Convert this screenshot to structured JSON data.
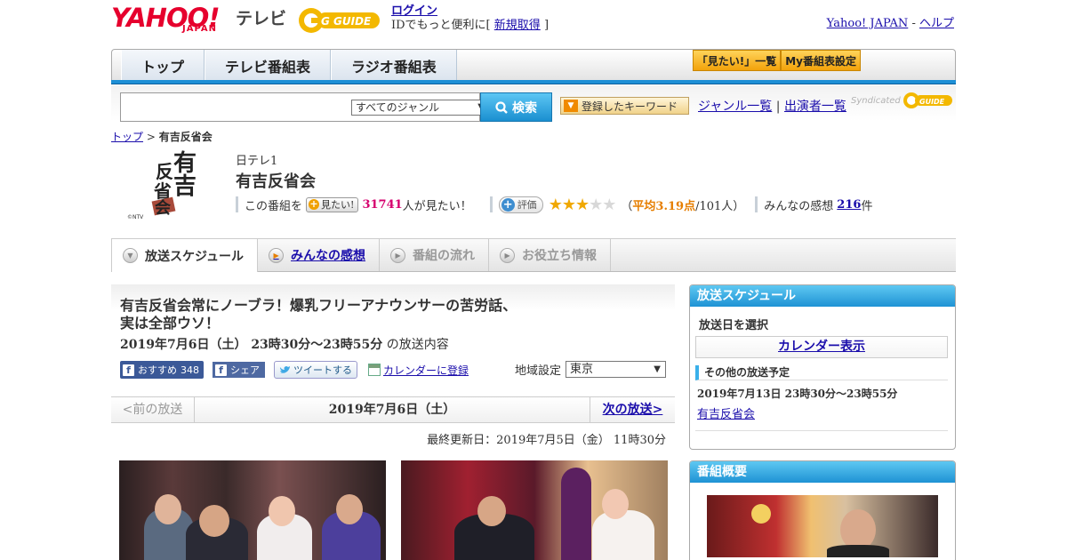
{
  "header": {
    "logo_yahoo": "YAHOO!",
    "logo_japan": "JAPAN",
    "logo_tv": "テレビ",
    "logo_gguide": "G GUIDE",
    "login_label": "ログイン",
    "login_desc": "IDでもっと便利に[",
    "register_label": "新規取得",
    "register_close": "]",
    "yahoo_japan_link": "Yahoo! JAPAN",
    "separator": "-",
    "help_link": "ヘルプ"
  },
  "nav": {
    "tabs": [
      "トップ",
      "テレビ番組表",
      "ラジオ番組表"
    ],
    "mitai_list": "「見たい!」一覧",
    "my_schedule": "My番組表設定"
  },
  "search": {
    "input_value": "",
    "genre_selected": "すべてのジャンル",
    "search_button": "検索",
    "keyword_button": "登録したキーワード",
    "genre_list_link": "ジャンル一覧",
    "link_separator": "|",
    "performer_list_link": "出演者一覧",
    "syndicated": "Syndicated",
    "syndicated_logo": "GUIDE"
  },
  "breadcrumb": {
    "top": "トップ",
    "separator": ">",
    "current": "有吉反省会"
  },
  "program": {
    "logo_text": "有吉反省会",
    "logo_credit": "©NTV",
    "station": "日テレ1",
    "title": "有吉反省会",
    "prefix": "この番組を",
    "mitai_button": "見たい!",
    "mitai_count": "31741",
    "mitai_suffix": "人が見たい！",
    "rating_button": "評価",
    "stars_filled": 3,
    "stars_total": 5,
    "rating_open": "（",
    "rating_avg": "平均3.19点",
    "rating_count": "/101人）",
    "kansou_label": "みんなの感想",
    "kansou_count": "216",
    "kansou_suffix": "件"
  },
  "content_tabs": [
    "放送スケジュール",
    "みんなの感想",
    "番組の流れ",
    "お役立ち情報"
  ],
  "episode": {
    "title_line1": "有吉反省会常にノーブラ！爆乳フリーアナウンサーの苦労話、",
    "title_line2": "実は全部ウソ！",
    "air_time": "2019年7月6日（土） 23時30分～23時55分",
    "air_suffix": " の放送内容",
    "fb_recommend": "おすすめ",
    "fb_count": "348",
    "fb_share": "シェア",
    "tweet": "ツイートする",
    "calendar_register": "カレンダーに登録",
    "region_label": "地域設定",
    "region_selected": "東京"
  },
  "pager": {
    "prev": "<前の放送",
    "date": "2019年7月6日（土）",
    "next": "次の放送>"
  },
  "updated": "最終更新日：2019年7月5日（金） 11時30分",
  "sidebar": {
    "schedule_heading": "放送スケジュール",
    "select_date": "放送日を選択",
    "calendar_button": "カレンダー表示",
    "other_heading": "その他の放送予定",
    "other_date": "2019年7月13日 23時30分～23時55分",
    "other_link": "有吉反省会",
    "summary_heading": "番組概要"
  }
}
